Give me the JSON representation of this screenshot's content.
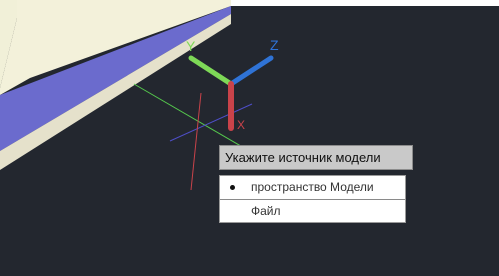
{
  "viewport": {
    "background": "#23272f",
    "axis_colors": {
      "x": "#c9434a",
      "y": "#7ed957",
      "z": "#2f73d6"
    },
    "labels": {
      "x": "X",
      "y": "Y",
      "z": "Z"
    }
  },
  "tooltip": {
    "text": "Укажите источник модели"
  },
  "menu": {
    "items": [
      {
        "label": "пространство Модели",
        "selected": true
      },
      {
        "label": "Файл",
        "selected": false
      }
    ]
  }
}
